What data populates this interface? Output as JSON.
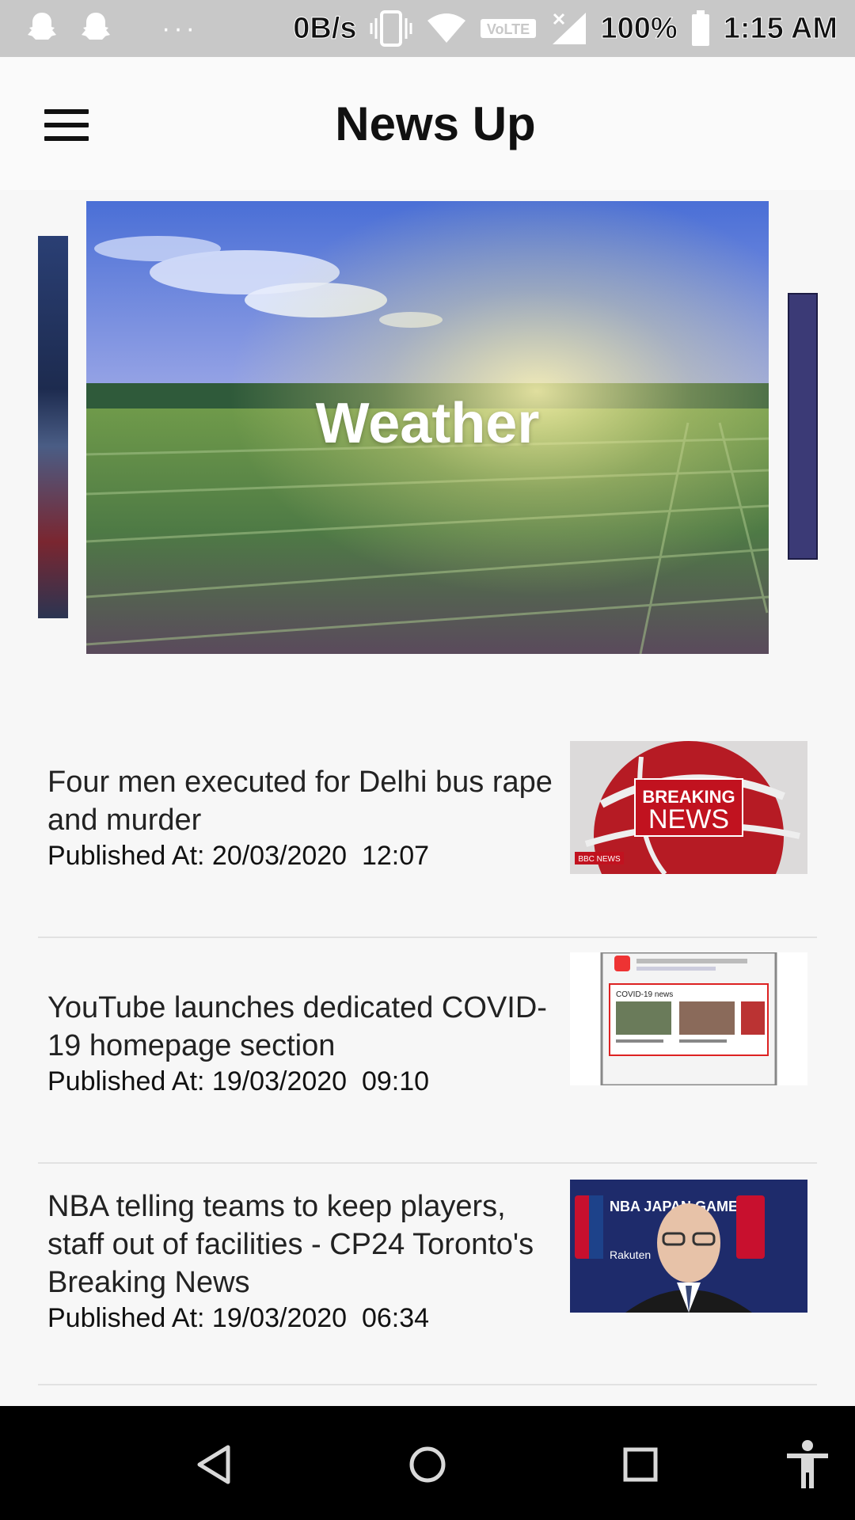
{
  "status_bar": {
    "net_speed": "0B/s",
    "volte": "VoLTE",
    "battery": "100%",
    "time": "1:15 AM",
    "dots": "···",
    "icons": [
      "snapchat-icon",
      "snapchat-icon",
      "vibrate-icon",
      "wifi-icon",
      "signal-icon",
      "battery-icon"
    ]
  },
  "app_bar": {
    "title": "News Up",
    "menu_icon": "hamburger-menu-icon"
  },
  "carousel": {
    "active": {
      "title": "Weather"
    }
  },
  "news": [
    {
      "title": "Four men executed for Delhi bus rape and murder",
      "published": "Published At: 20/03/2020  12:07",
      "thumb_text_1": "BREAKING",
      "thumb_text_2": "NEWS",
      "thumb_text_3": "BBC NEWS"
    },
    {
      "title": "YouTube launches dedicated COVID-19 homepage section",
      "published": "Published At: 19/03/2020  09:10",
      "thumb_text_1": "COVID-19 news"
    },
    {
      "title": "NBA telling teams to keep players, staff out of facilities - CP24 Toronto's Breaking News",
      "published": "Published At: 19/03/2020  06:34",
      "thumb_text_1": "NBA JAPAN GAMES",
      "thumb_text_2": "Rakuten"
    }
  ],
  "nav_bar": {
    "icons": [
      "back-icon",
      "home-icon",
      "recents-icon",
      "accessibility-icon"
    ]
  },
  "colors": {
    "status_bar": "#c8c8c8",
    "app_bar": "#fafafa",
    "content_bg": "#f7f7f7",
    "nav_bar": "#000000",
    "breaking_red": "#c1121f"
  }
}
